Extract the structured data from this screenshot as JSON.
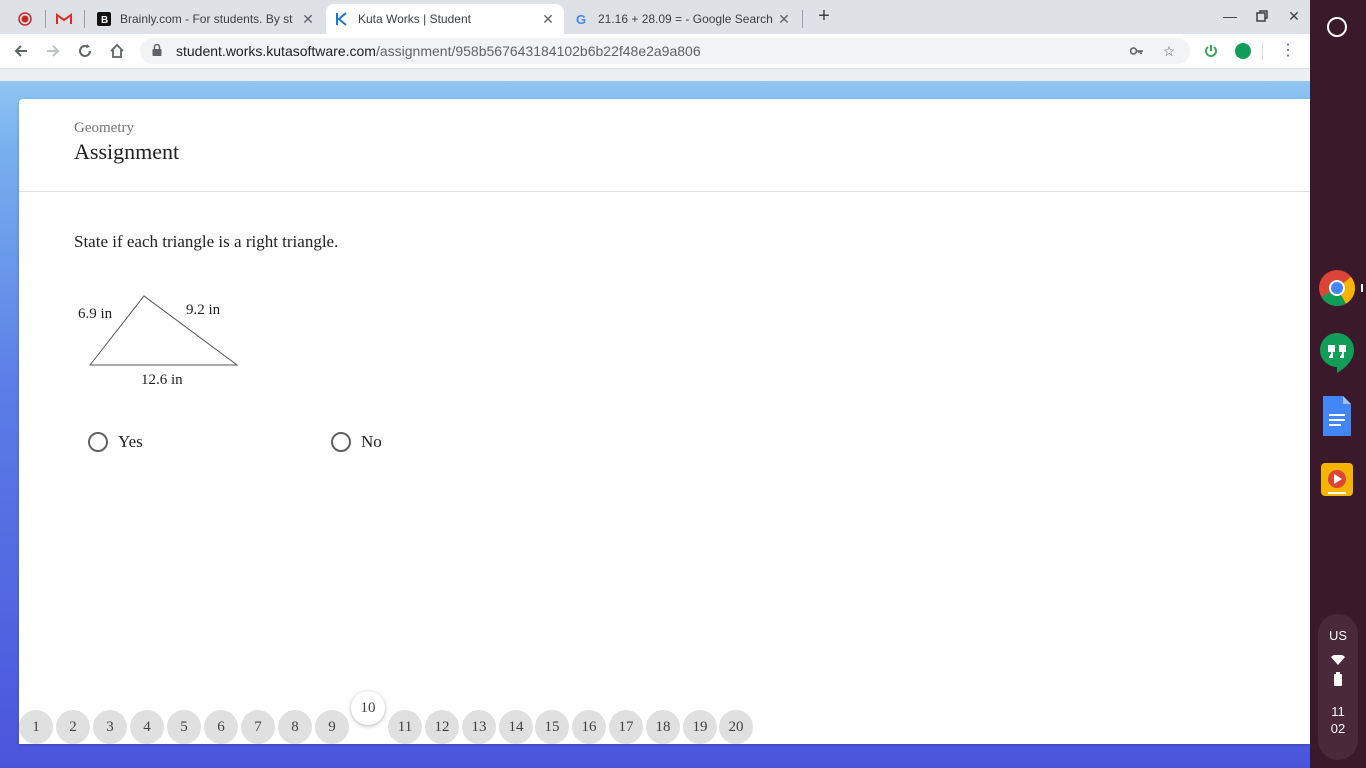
{
  "browser": {
    "tabs": [
      {
        "title": "",
        "icon": "record-icon",
        "active": false
      },
      {
        "title": "",
        "icon": "gmail-icon",
        "active": false
      },
      {
        "title": "Brainly.com - For students. By st",
        "icon": "brainly-icon",
        "active": false
      },
      {
        "title": "Kuta Works | Student",
        "icon": "kuta-icon",
        "active": true
      },
      {
        "title": "21.16 + 28.09 = - Google Search",
        "icon": "google-icon",
        "active": false
      }
    ],
    "url_host": "student.works.kutasoftware.com",
    "url_path": "/assignment/958b567643184102b6b22f48e2a9a806"
  },
  "page": {
    "subject": "Geometry",
    "heading": "Assignment",
    "instruction": "State if each triangle is a right triangle.",
    "figure": {
      "left_side": "6.9 in",
      "right_side": "9.2 in",
      "base": "12.6 in"
    },
    "choices": [
      "Yes",
      "No"
    ],
    "pager": {
      "pages": [
        "1",
        "2",
        "3",
        "4",
        "5",
        "6",
        "7",
        "8",
        "9",
        "10",
        "11",
        "12",
        "13",
        "14",
        "15",
        "16",
        "17",
        "18",
        "19",
        "20"
      ],
      "current": "10"
    }
  },
  "shelf": {
    "apps": [
      "chrome-icon",
      "hangouts-icon",
      "docs-icon",
      "slides-icon"
    ],
    "locale": "US",
    "time_hour": "11",
    "time_min": "02"
  }
}
